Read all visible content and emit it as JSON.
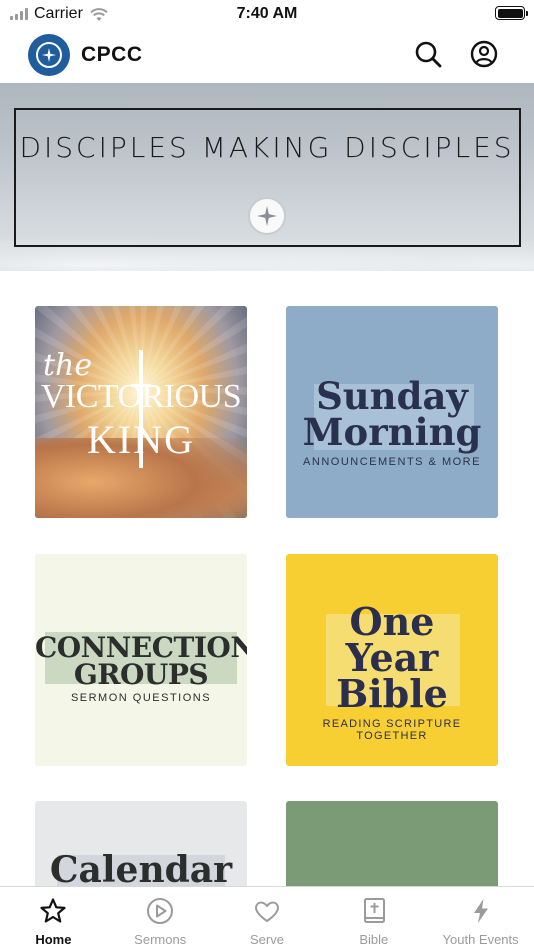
{
  "status_bar": {
    "carrier": "Carrier",
    "time": "7:40 AM"
  },
  "header": {
    "title": "CPCC",
    "icons": [
      "search-icon",
      "account-icon"
    ]
  },
  "hero": {
    "text": "DISCIPLES MAKING DISCIPLES"
  },
  "tiles": [
    {
      "line0": "the",
      "line1": "VICTORIOUS",
      "line2": "KING"
    },
    {
      "title_line1": "Sunday",
      "title_line2": "Morning",
      "subtitle": "ANNOUNCEMENTS & MORE"
    },
    {
      "title_line1": "CONNECTION",
      "title_line2": "GROUPS",
      "subtitle": "SERMON QUESTIONS"
    },
    {
      "title_line1": "One",
      "title_line2": "Year",
      "title_line3": "Bible",
      "subtitle": "READING SCRIPTURE TOGETHER"
    },
    {
      "title_line1": "Calendar"
    },
    {}
  ],
  "tab_bar": {
    "items": [
      {
        "label": "Home",
        "icon": "star-icon",
        "active": true
      },
      {
        "label": "Sermons",
        "icon": "play-circle-icon"
      },
      {
        "label": "Serve",
        "icon": "heart-icon"
      },
      {
        "label": "Bible",
        "icon": "bible-icon"
      },
      {
        "label": "Youth Events",
        "icon": "bolt-icon"
      }
    ]
  },
  "colors": {
    "brand": "#1f5d9c",
    "active_tab": "#111111",
    "inactive_tab": "#9b9b9b"
  }
}
